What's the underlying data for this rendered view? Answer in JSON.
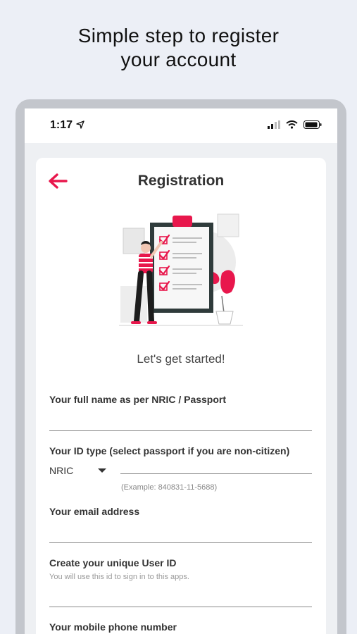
{
  "headline": {
    "line1": "Simple step to register",
    "line2": "your account"
  },
  "status_bar": {
    "time": "1:17",
    "icons": [
      "location-arrow-icon",
      "signal-icon",
      "wifi-icon",
      "battery-icon"
    ]
  },
  "header": {
    "back_icon": "arrow-left-icon",
    "title": "Registration"
  },
  "illustration": "clipboard-checklist-illustration",
  "subtitle": "Let's get started!",
  "form": {
    "full_name_label": "Your full name as per NRIC / Passport",
    "id_type_label": "Your ID type (select passport if you are non-citizen)",
    "id_type_value": "NRIC",
    "id_example": "(Example: 840831-11-5688)",
    "email_label": "Your email address",
    "user_id_label": "Create your unique User ID",
    "user_id_help": "You will use this id to sign in to this apps.",
    "phone_label": "Your mobile phone number"
  },
  "colors": {
    "accent": "#e8174c",
    "background": "#eceff6",
    "device_frame": "#c3c6cc"
  }
}
